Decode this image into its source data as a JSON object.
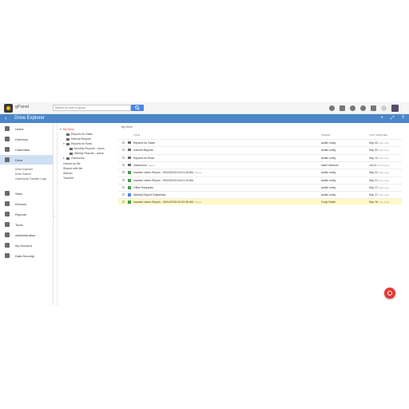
{
  "topbar": {
    "app_title": "gPanel",
    "search_placeholder": "Search for user or group"
  },
  "header": {
    "title": "Drive Explorer"
  },
  "nav": {
    "items": [
      {
        "label": "Users"
      },
      {
        "label": "Directory"
      },
      {
        "label": "Calendars"
      },
      {
        "label": "Drive"
      },
      {
        "label": "Sites"
      },
      {
        "label": "Devices"
      },
      {
        "label": "Reports"
      },
      {
        "label": "Tools"
      },
      {
        "label": "Administration"
      },
      {
        "label": "My Account"
      },
      {
        "label": "Data Security"
      }
    ],
    "drive_sub": [
      "Drive Explorer",
      "Drive Search",
      "Ownership Transfer Logs"
    ]
  },
  "tree": {
    "my_drive": "My Drive",
    "reports_for_sales": "Reports for Sales",
    "internal_reports": "Internal Reports",
    "reports_for_boss": "Reports for Boss",
    "monthly_reports": "Monthly Reports - Users",
    "weekly_reports": "Weekly Reports - Users",
    "classroom": "Classroom",
    "owned_by_me": "Owned by Me",
    "shared_with_me": "Shared with Me",
    "starred": "Starred",
    "trashed": "Trashed"
  },
  "content": {
    "breadcrumb": "My Drive",
    "columns": {
      "title": "TITLE",
      "owner": "OWNER",
      "modified": "LAST MODIFIED"
    },
    "rows": [
      {
        "icon": "folder",
        "title": "Reports for Sales",
        "tag": "",
        "owner": "ashlin oxley",
        "date": "Sep 22",
        "who": "ashlin oxley"
      },
      {
        "icon": "folder",
        "title": "Internal Reports",
        "tag": "",
        "owner": "ashlin oxley",
        "date": "Sep 22",
        "who": "ashlin oxley"
      },
      {
        "icon": "folder",
        "title": "Reports for Boss",
        "tag": "",
        "owner": "ashlin oxley",
        "date": "Sep 14",
        "who": "ashlin oxley"
      },
      {
        "icon": "folder",
        "title": "Classroom",
        "tag": "Shared",
        "owner": "Nate Harrison",
        "date": "Jul 21",
        "who": "Nate Harrison"
      },
      {
        "icon": "sheet",
        "title": "Inactive Users Report - 09/22/2015 04:01:18 AM",
        "tag": "Shared",
        "owner": "ashlin oxley",
        "date": "Sep 22",
        "who": "ashlin oxley"
      },
      {
        "icon": "sheet",
        "title": "Inactive Users Report - 09/22/2015 04:01:19 AM",
        "tag": "",
        "owner": "ashlin oxley",
        "date": "Sep 21",
        "who": "ashlin oxley"
      },
      {
        "icon": "sheet",
        "title": "Office Requests",
        "tag": "",
        "owner": "ashlin oxley",
        "date": "Sep 17",
        "who": "ashlin oxley"
      },
      {
        "icon": "doc",
        "title": "Weekly Report Guidelines",
        "tag": "",
        "owner": "ashlin oxley",
        "date": "Sep 17",
        "who": "ashlin oxley"
      },
      {
        "icon": "sheet",
        "title": "Inactive Users Report - 09/14/2015 00:02:05 AM",
        "tag": "Shared",
        "owner": "Cody Smith",
        "date": "Sep 16",
        "who": "Cody Smith"
      }
    ]
  }
}
